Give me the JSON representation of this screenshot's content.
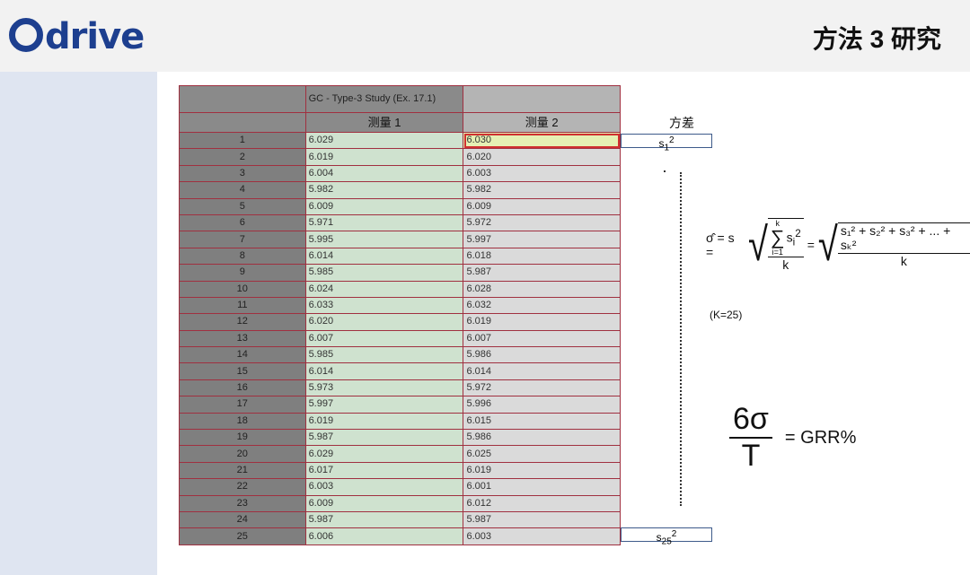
{
  "header": {
    "logo": "drive",
    "title": "方法 3 研究"
  },
  "table": {
    "study_title": "GC - Type-3 Study (Ex. 17.1)",
    "columns": [
      "测量 1",
      "测量 2"
    ],
    "rows": [
      [
        "1",
        "6.029",
        "6.030"
      ],
      [
        "2",
        "6.019",
        "6.020"
      ],
      [
        "3",
        "6.004",
        "6.003"
      ],
      [
        "4",
        "5.982",
        "5.982"
      ],
      [
        "5",
        "6.009",
        "6.009"
      ],
      [
        "6",
        "5.971",
        "5.972"
      ],
      [
        "7",
        "5.995",
        "5.997"
      ],
      [
        "8",
        "6.014",
        "6.018"
      ],
      [
        "9",
        "5.985",
        "5.987"
      ],
      [
        "10",
        "6.024",
        "6.028"
      ],
      [
        "11",
        "6.033",
        "6.032"
      ],
      [
        "12",
        "6.020",
        "6.019"
      ],
      [
        "13",
        "6.007",
        "6.007"
      ],
      [
        "14",
        "5.985",
        "5.986"
      ],
      [
        "15",
        "6.014",
        "6.014"
      ],
      [
        "16",
        "5.973",
        "5.972"
      ],
      [
        "17",
        "5.997",
        "5.996"
      ],
      [
        "18",
        "6.019",
        "6.015"
      ],
      [
        "19",
        "5.987",
        "5.986"
      ],
      [
        "20",
        "6.029",
        "6.025"
      ],
      [
        "21",
        "6.017",
        "6.019"
      ],
      [
        "22",
        "6.003",
        "6.001"
      ],
      [
        "23",
        "6.009",
        "6.012"
      ],
      [
        "24",
        "5.987",
        "5.987"
      ],
      [
        "25",
        "6.006",
        "6.003"
      ]
    ],
    "selected_cell": "6.030"
  },
  "variance": {
    "heading": "方差",
    "first": {
      "base": "s",
      "sub": "1",
      "sup": "2"
    },
    "last": {
      "base": "s",
      "sub": "25",
      "sup": "2"
    }
  },
  "formula": {
    "lhs": "σ̂ = s =",
    "sum_top": "k",
    "sum_bottom": "i=1",
    "sum_term": "s",
    "sum_sub": "i",
    "den": "k",
    "eq": "=",
    "expanded": "s₁² + s₂² + s₃² + ... + sₖ²"
  },
  "k_note": "(K=25)",
  "grr": {
    "numerator": "6σ",
    "denominator": "T",
    "result": "= GRR%"
  }
}
